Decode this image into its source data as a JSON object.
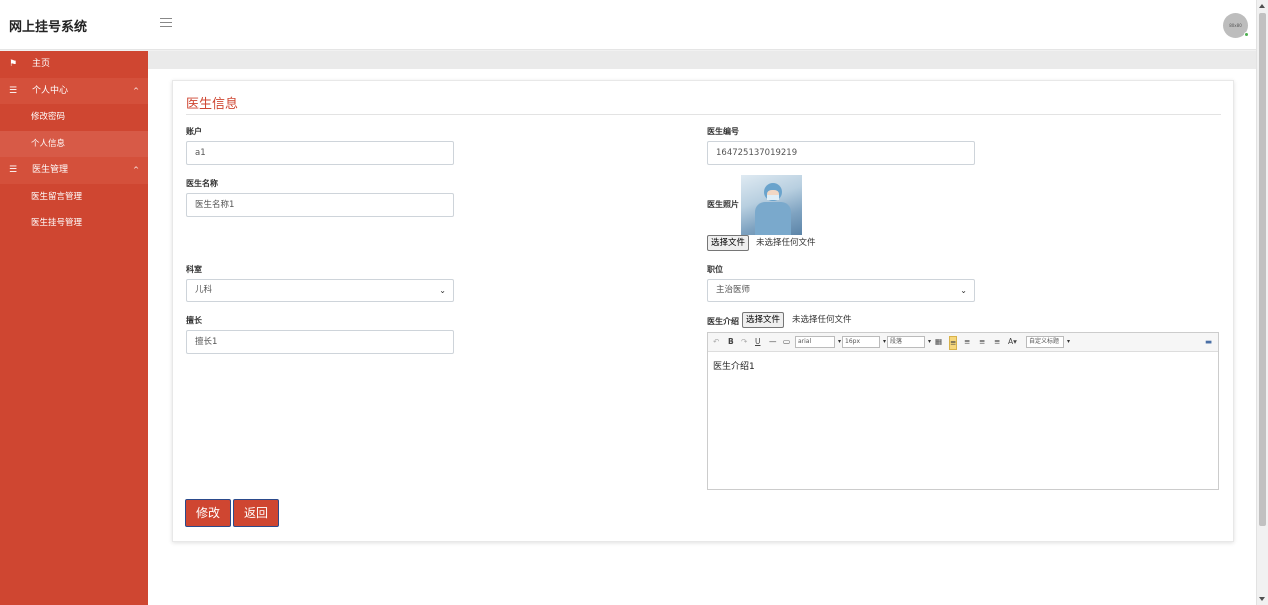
{
  "app": {
    "title": "网上挂号系统"
  },
  "header": {
    "avatar_text": "80x80"
  },
  "sidebar": {
    "home": "主页",
    "groups": [
      {
        "label": "个人中心",
        "items": [
          "修改密码",
          "个人信息"
        ]
      },
      {
        "label": "医生管理",
        "items": [
          "医生留言管理",
          "医生挂号管理"
        ]
      }
    ],
    "active_item": "个人信息"
  },
  "card": {
    "title": "医生信息"
  },
  "form": {
    "account_label": "账户",
    "account_value": "a1",
    "doctor_no_label": "医生编号",
    "doctor_no_value": "164725137019219",
    "doctor_name_label": "医生名称",
    "doctor_name_value": "医生名称1",
    "photo_label": "医生照片",
    "choose_file": "选择文件",
    "no_file": "未选择任何文件",
    "department_label": "科室",
    "department_value": "儿科",
    "position_label": "职位",
    "position_value": "主治医师",
    "specialty_label": "擅长",
    "specialty_value": "擅长1",
    "intro_label": "医生介绍",
    "intro_value": "医生介绍1"
  },
  "editor_toolbar": {
    "font_family": "arial",
    "font_size": "16px",
    "paragraph": "段落",
    "custom_title": "自定义标题"
  },
  "buttons": {
    "modify": "修改",
    "back": "返回"
  },
  "colors": {
    "accent": "#cf4631",
    "sidebar": "#cf4631"
  }
}
